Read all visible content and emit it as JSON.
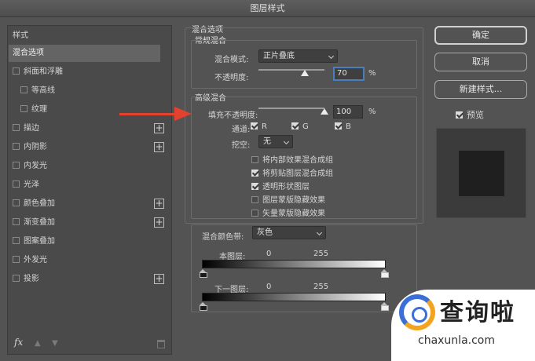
{
  "window": {
    "title": "图层样式"
  },
  "styles_panel": {
    "header": "样式",
    "items": [
      {
        "label": "混合选项",
        "selected": true
      },
      {
        "label": "斜面和浮雕",
        "checkbox": true
      },
      {
        "label": "等高线",
        "checkbox": true,
        "indent": true
      },
      {
        "label": "纹理",
        "checkbox": true,
        "indent": true
      },
      {
        "label": "描边",
        "checkbox": true,
        "plus": true
      },
      {
        "label": "内阴影",
        "checkbox": true,
        "plus": true
      },
      {
        "label": "内发光",
        "checkbox": true
      },
      {
        "label": "光泽",
        "checkbox": true
      },
      {
        "label": "颜色叠加",
        "checkbox": true,
        "plus": true
      },
      {
        "label": "渐变叠加",
        "checkbox": true,
        "plus": true
      },
      {
        "label": "图案叠加",
        "checkbox": true
      },
      {
        "label": "外发光",
        "checkbox": true
      },
      {
        "label": "投影",
        "checkbox": true,
        "plus": true
      }
    ],
    "fx_label": "fx",
    "plus_symbol": "+"
  },
  "blending": {
    "section_title": "混合选项",
    "general": {
      "title": "常规混合",
      "mode_label": "混合模式:",
      "mode_value": "正片叠底",
      "opacity_label": "不透明度:",
      "opacity_value": "70",
      "opacity_unit": "%",
      "opacity_level": 0.7
    },
    "advanced": {
      "title": "高级混合",
      "fill_opacity_label": "填充不透明度:",
      "fill_opacity_value": "100",
      "fill_opacity_unit": "%",
      "fill_opacity_level": 1.0,
      "channels_label": "通道:",
      "channel_r": "R",
      "channel_g": "G",
      "channel_b": "B",
      "knockout_label": "挖空:",
      "knockout_value": "无",
      "options": [
        {
          "label": "将内部效果混合成组",
          "checked": false
        },
        {
          "label": "将剪贴图层混合成组",
          "checked": true
        },
        {
          "label": "透明形状图层",
          "checked": true
        },
        {
          "label": "图层蒙版隐藏效果",
          "checked": false
        },
        {
          "label": "矢量蒙版隐藏效果",
          "checked": false
        }
      ]
    },
    "blend_if": {
      "label": "混合颜色带:",
      "value": "灰色",
      "this_layer_label": "本图层:",
      "this_layer_min": "0",
      "this_layer_max": "255",
      "underlying_label": "下一图层:",
      "underlying_min": "0",
      "underlying_max": "255"
    }
  },
  "actions": {
    "ok": "确定",
    "cancel": "取消",
    "new_style": "新建样式...",
    "preview_label": "预览"
  },
  "watermark": {
    "text": "查询啦",
    "url": "chaxunla.com"
  },
  "colors": {
    "annotation_arrow": "#e5412f",
    "focus_ring": "#4a7fbf"
  }
}
